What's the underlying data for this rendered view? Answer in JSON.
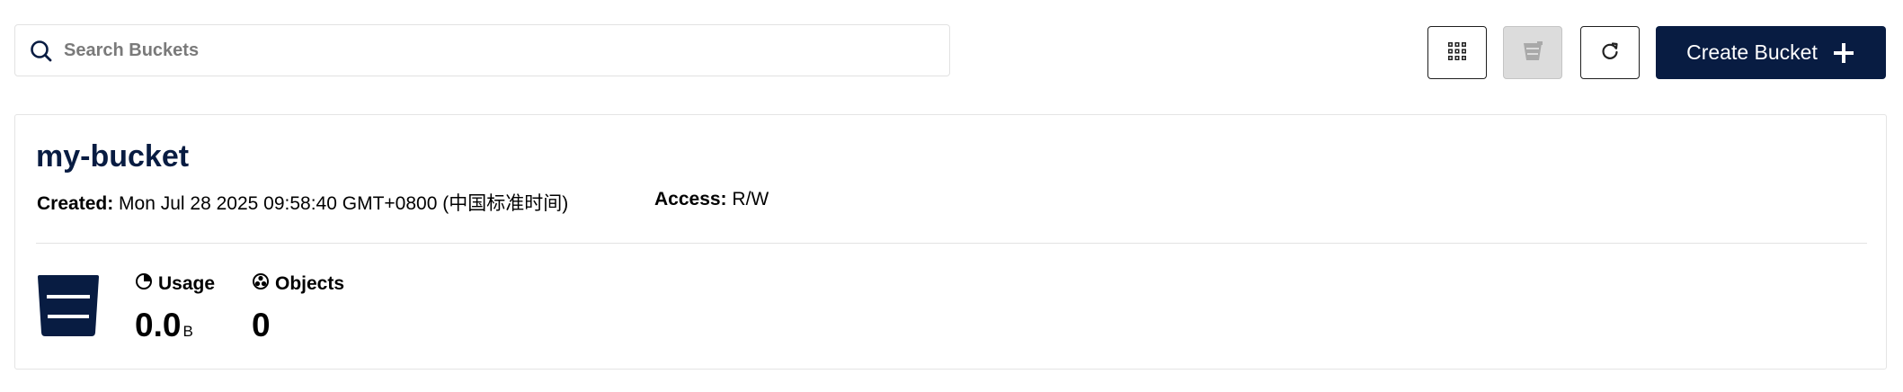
{
  "search": {
    "placeholder": "Search Buckets",
    "value": ""
  },
  "toolbar": {
    "grid_icon": "grid-view-icon",
    "bucket_icon": "bucket-icon",
    "refresh_icon": "refresh-icon",
    "create_label": "Create Bucket",
    "create_icon": "plus-icon",
    "bucket_button_disabled": true
  },
  "bucket": {
    "name": "my-bucket",
    "created_label": "Created:",
    "created_value": "Mon Jul 28 2025 09:58:40 GMT+0800 (中国标准时间)",
    "access_label": "Access:",
    "access_value": "R/W",
    "logo_icon": "bucket-logo-icon",
    "usage": {
      "label": "Usage",
      "icon": "pie-chart-icon",
      "value": "0.0",
      "unit": "B"
    },
    "objects": {
      "label": "Objects",
      "icon": "objects-icon",
      "value": "0"
    }
  },
  "colors": {
    "primary": "#081c42",
    "border": "#e4e4e4",
    "disabled_bg": "#dcdcdc",
    "text": "#000000"
  }
}
